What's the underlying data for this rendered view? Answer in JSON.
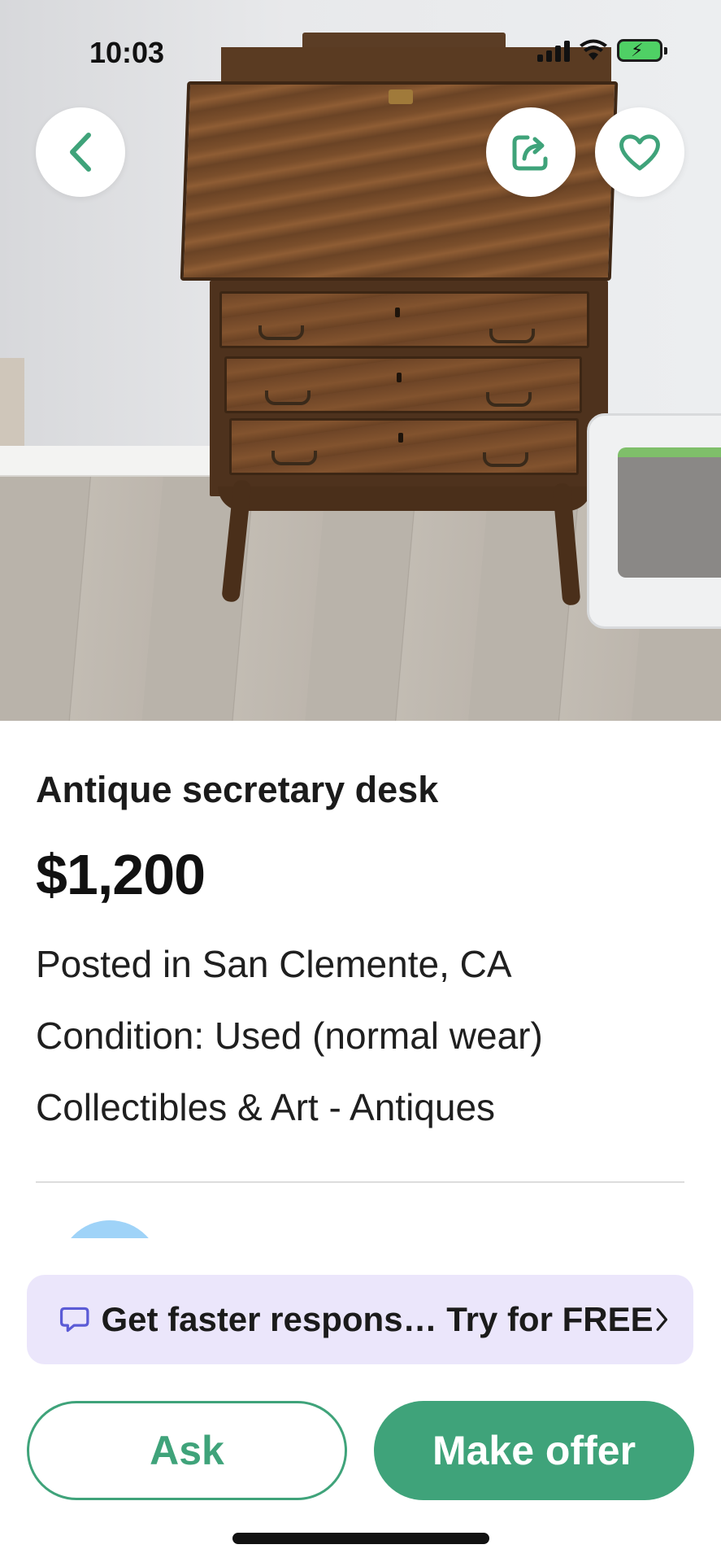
{
  "status_bar": {
    "time": "10:03"
  },
  "photo": {
    "subject": "antique-desk-photo"
  },
  "actions_top": {
    "back_icon": "chevron-left-icon",
    "share_icon": "share-icon",
    "favorite_icon": "heart-icon"
  },
  "listing": {
    "title": "Antique secretary desk",
    "price": "$1,200",
    "location": "Posted in San Clemente, CA",
    "condition": "Condition: Used (normal wear)",
    "category": "Collectibles & Art - Antiques"
  },
  "promo": {
    "text": "Get faster respons… Try for FREE",
    "icon": "chat-bubble-icon"
  },
  "buttons": {
    "ask": "Ask",
    "make_offer": "Make offer"
  },
  "colors": {
    "accent": "#3fa37a",
    "promo_bg": "#ebe6fb",
    "promo_icon": "#5b5bd6"
  }
}
